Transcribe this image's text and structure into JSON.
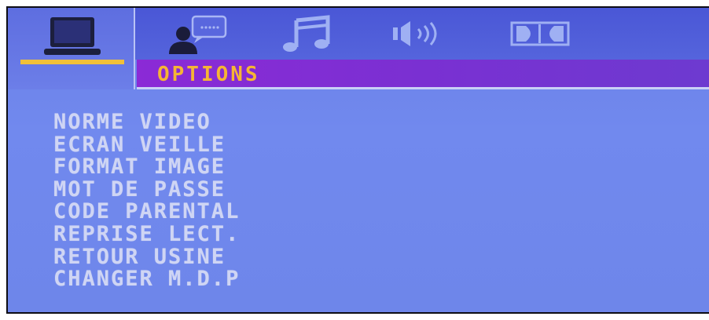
{
  "tabs": [
    {
      "icon": "monitor-icon",
      "selected": true
    },
    {
      "icon": "person-speech-icon",
      "selected": false
    },
    {
      "icon": "music-note-icon",
      "selected": false
    },
    {
      "icon": "speaker-icon",
      "selected": false
    },
    {
      "icon": "dolby-icon",
      "selected": false
    }
  ],
  "section_title": "OPTIONS",
  "menu": {
    "items": [
      "NORME VIDEO",
      "ECRAN VEILLE",
      "FORMAT IMAGE",
      "MOT DE PASSE",
      "CODE PARENTAL",
      "REPRISE LECT.",
      "RETOUR USINE",
      "CHANGER M.D.P"
    ]
  },
  "colors": {
    "background": "#7189ee",
    "icon_bar": "#4a57d6",
    "title_bar": "#8b2ad6",
    "title_text": "#f6b534",
    "menu_text": "#cfd5f4",
    "selection_underline": "#f0c03a"
  }
}
